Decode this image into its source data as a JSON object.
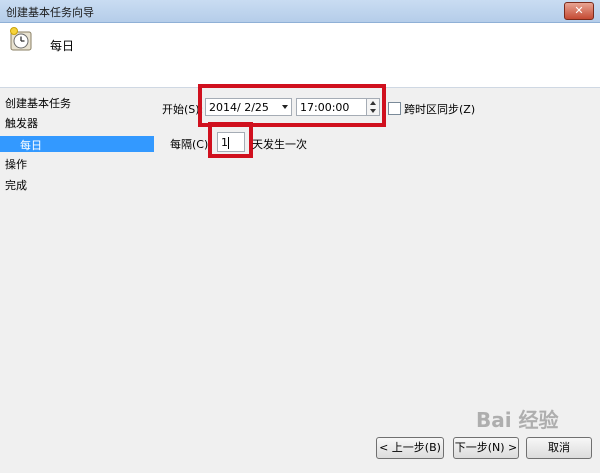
{
  "window": {
    "title": "创建基本任务向导",
    "close_label": "✕"
  },
  "header": {
    "title": "每日",
    "icon": "clock-icon"
  },
  "sidebar": {
    "items": [
      {
        "label": "创建基本任务"
      },
      {
        "label": "触发器"
      },
      {
        "label": "每日",
        "selected": true
      },
      {
        "label": "操作"
      },
      {
        "label": "完成"
      }
    ]
  },
  "form": {
    "start_label": "开始(S):",
    "start_date": "2014/  2/25",
    "start_time": "17:00:00",
    "sync_label": "跨时区同步(Z)",
    "sync_checked": false,
    "recur_label": "每隔(C):",
    "recur_value": "1",
    "recur_suffix": "天发生一次"
  },
  "buttons": {
    "back": "< 上一步(B)",
    "next": "下一步(N) >",
    "cancel": "取消"
  },
  "watermark": "Bai 经验",
  "colors": {
    "highlight": "#d0101e",
    "selection": "#3399ff"
  }
}
